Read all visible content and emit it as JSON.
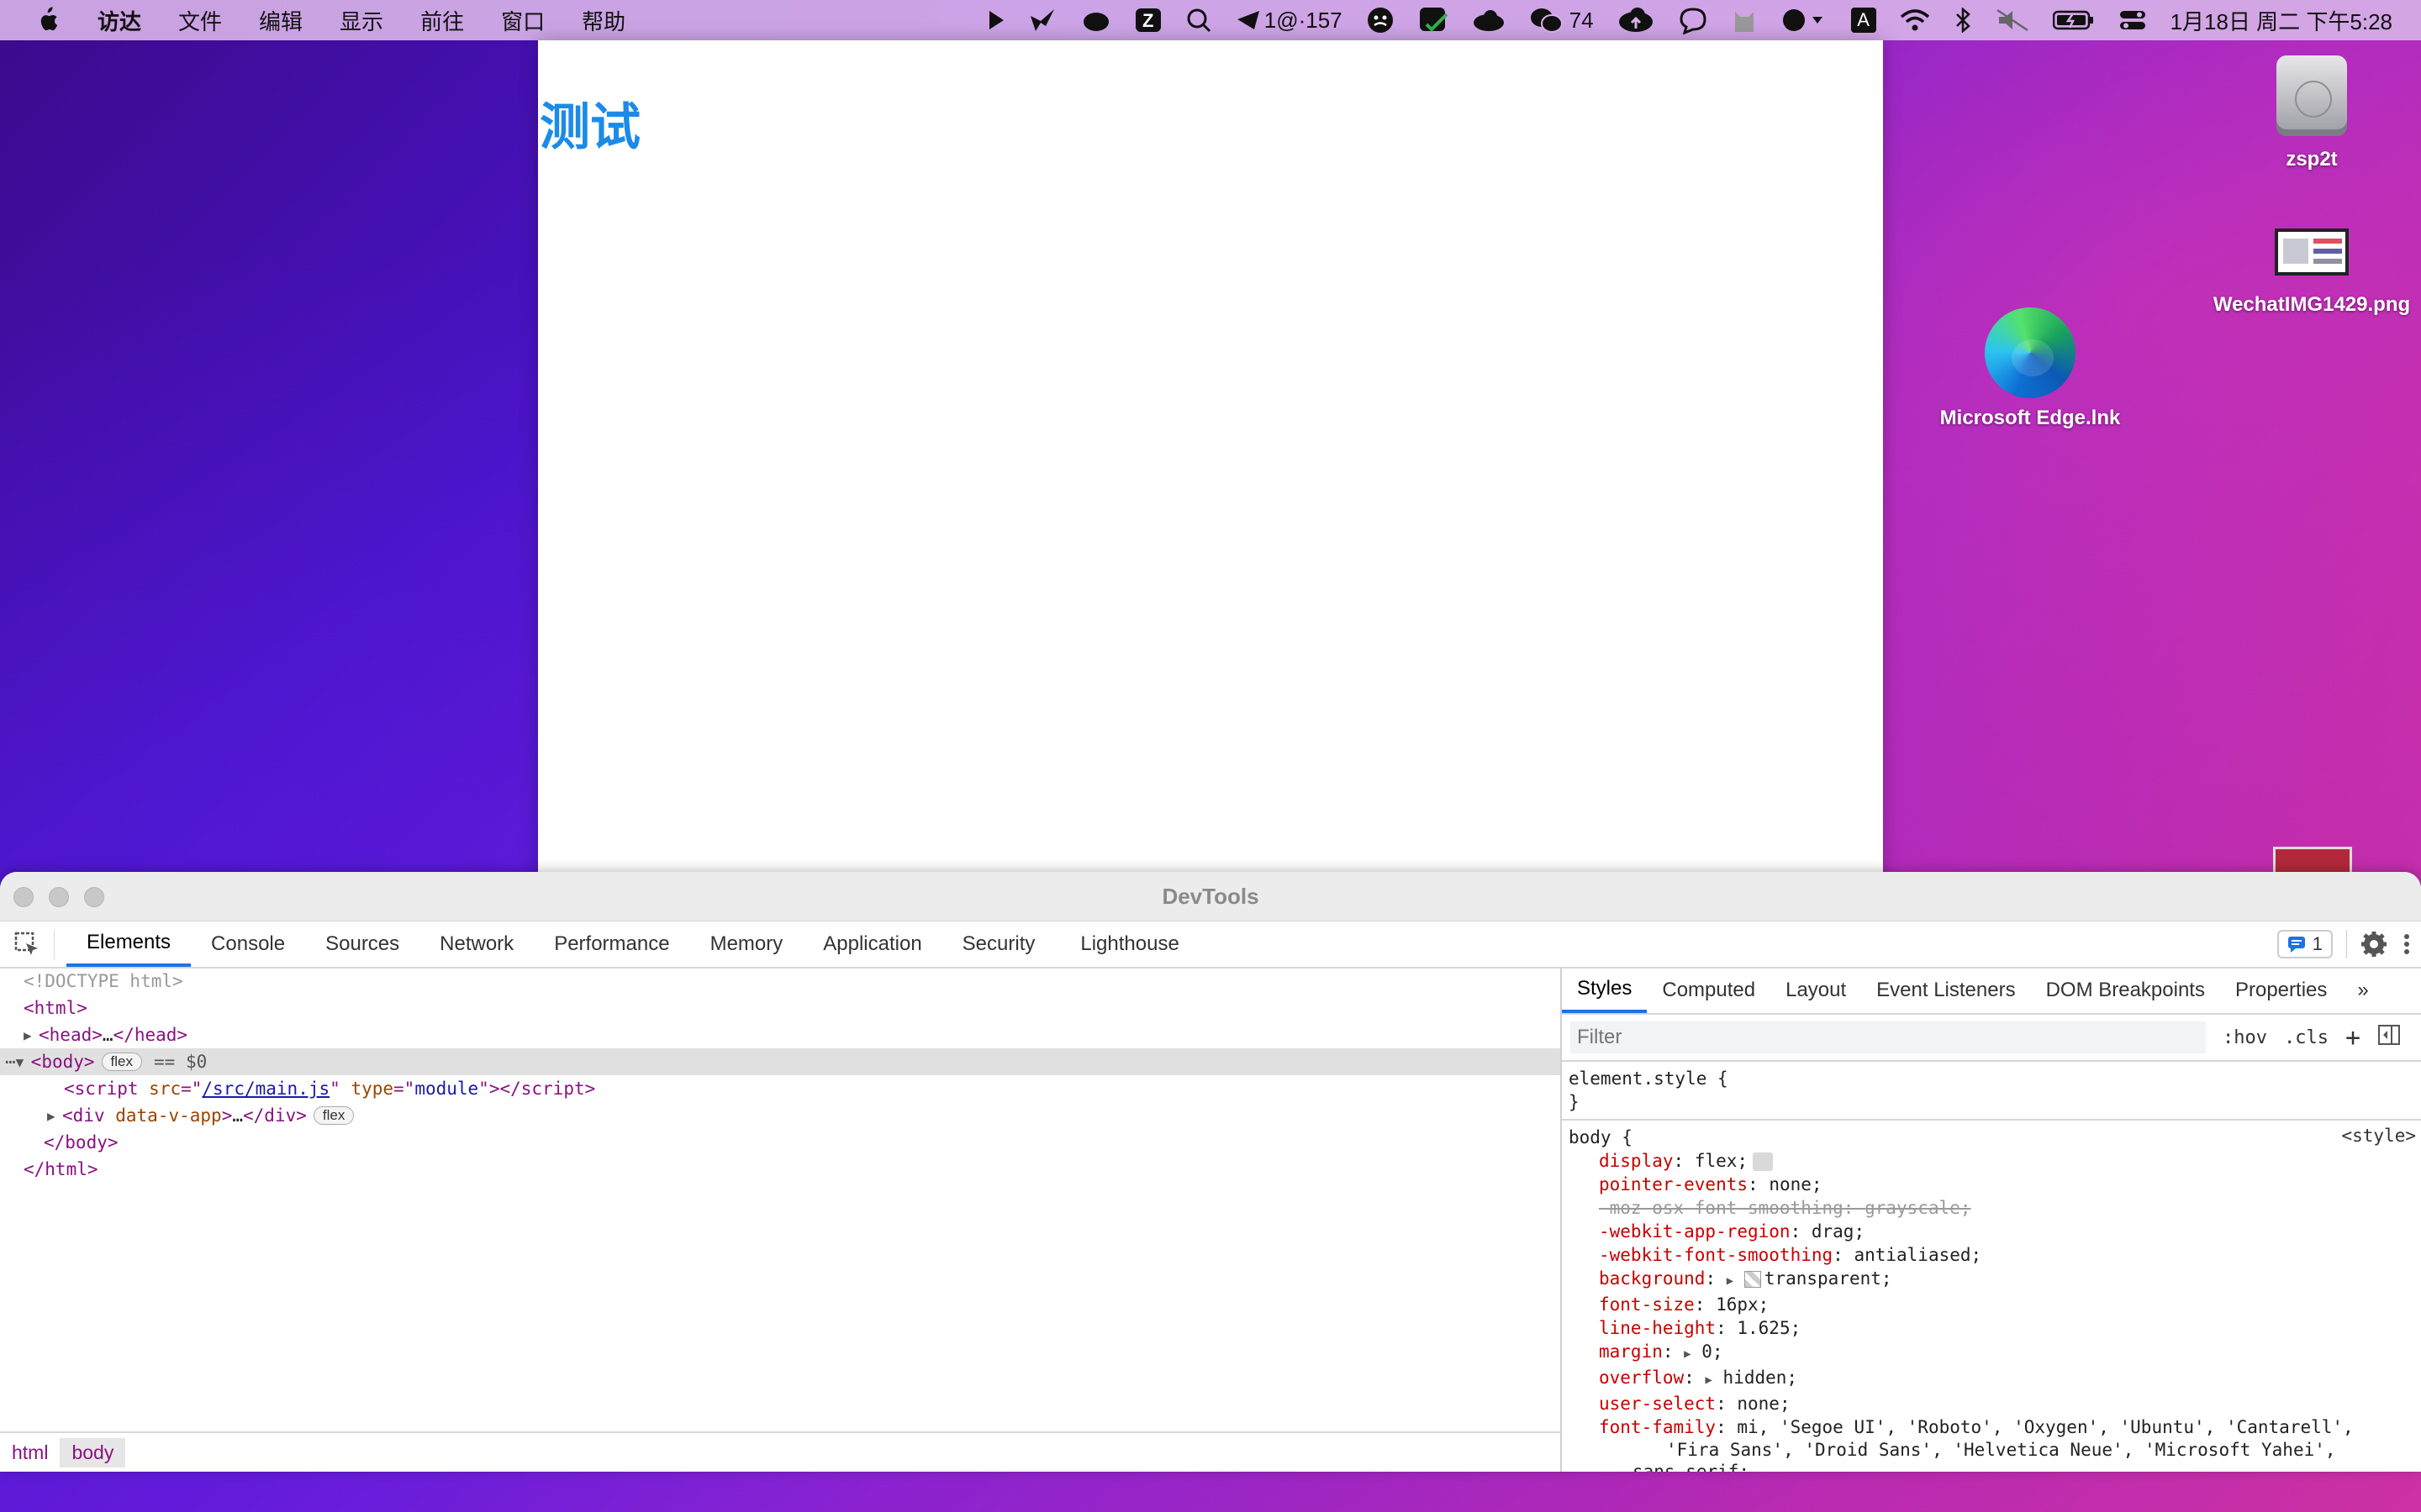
{
  "menubar": {
    "app": "访达",
    "items": [
      "文件",
      "编辑",
      "显示",
      "前往",
      "窗口",
      "帮助"
    ],
    "status_counter": "1@·157",
    "wechat_count": "74",
    "input_method": "A",
    "datetime": "1月18日 周二 下午5:28"
  },
  "desktop": {
    "icons": [
      {
        "label": "zsp2t"
      },
      {
        "label": "WechatIMG1429.png"
      },
      {
        "label": "Microsoft Edge.lnk"
      }
    ]
  },
  "browser": {
    "heading": "测试"
  },
  "devtools": {
    "title": "DevTools",
    "tabs": [
      "Elements",
      "Console",
      "Sources",
      "Network",
      "Performance",
      "Memory",
      "Application",
      "Security",
      "Lighthouse"
    ],
    "issues_count": "1",
    "dom": {
      "doctype": "<!DOCTYPE html>",
      "html_open": "<html>",
      "head": "head",
      "head_ellipsis": "…",
      "body_tag": "body",
      "body_pill": "flex",
      "body_marker": "== $0",
      "script_tag": "script",
      "script_src_attr": "src",
      "script_src": "/src/main.js",
      "script_type_attr": "type",
      "script_type": "module",
      "div_tag": "div",
      "div_attr": "data-v-app",
      "div_pill": "flex",
      "body_close": "</body>",
      "html_close": "</html>"
    },
    "breadcrumb": [
      "html",
      "body"
    ],
    "styles_tabs": [
      "Styles",
      "Computed",
      "Layout",
      "Event Listeners",
      "DOM Breakpoints",
      "Properties"
    ],
    "filter_placeholder": "Filter",
    "hov": ":hov",
    "cls": ".cls",
    "element_style": "element.style {",
    "close_brace": "}",
    "body_rule": {
      "selector": "body {",
      "source": "<style>",
      "props": [
        {
          "name": "display",
          "value": "flex;"
        },
        {
          "name": "pointer-events",
          "value": "none;"
        },
        {
          "name": "-moz-osx-font-smoothing",
          "value": "grayscale;"
        },
        {
          "name": "-webkit-app-region",
          "value": "drag;"
        },
        {
          "name": "-webkit-font-smoothing",
          "value": "antialiased;"
        },
        {
          "name": "background",
          "value": "transparent;"
        },
        {
          "name": "font-size",
          "value": "16px;"
        },
        {
          "name": "line-height",
          "value": "1.625;"
        },
        {
          "name": "margin",
          "value": "0;"
        },
        {
          "name": "overflow",
          "value": "hidden;"
        },
        {
          "name": "user-select",
          "value": "none;"
        },
        {
          "name": "font-family",
          "value": "mi, 'Segoe UI', 'Roboto', 'Oxygen', 'Ubuntu', 'Cantarell',"
        }
      ],
      "font_family_cont1": "'Fira Sans', 'Droid Sans', 'Helvetica Neue', 'Microsoft Yahei',",
      "font_family_cont2": "sans-serif;"
    }
  }
}
